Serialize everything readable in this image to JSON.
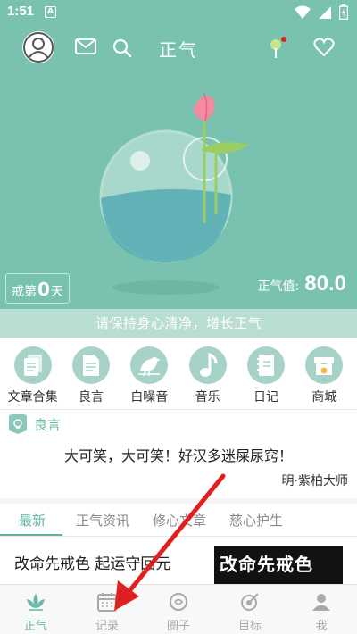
{
  "status_bar": {
    "time": "1:51",
    "badge": "A"
  },
  "topbar": {
    "title": "正气"
  },
  "hero": {
    "days_prefix": "戒第",
    "days_value": "0",
    "days_suffix": "天",
    "score_label": "正气值:",
    "score_value": "80.0",
    "slogan": "请保持身心清净，增长正气"
  },
  "quick_items": [
    {
      "label": "文章合集",
      "icon": "articles-icon"
    },
    {
      "label": "良言",
      "icon": "document-icon"
    },
    {
      "label": "白噪音",
      "icon": "bird-icon"
    },
    {
      "label": "音乐",
      "icon": "music-note-icon"
    },
    {
      "label": "日记",
      "icon": "diary-icon"
    },
    {
      "label": "商城",
      "icon": "shop-icon"
    }
  ],
  "quote": {
    "header": "良言",
    "text": "大可笑，大可笑！好汉多迷屎尿窍！",
    "author": "明·紫柏大师"
  },
  "tabs": [
    "最新",
    "正气资讯",
    "修心文章",
    "慈心护生"
  ],
  "article": {
    "title": "改命先戒色 起运守回元",
    "thumb_text": "改命先戒色"
  },
  "bottom_nav": [
    {
      "label": "正气",
      "icon": "lotus-icon",
      "active": true
    },
    {
      "label": "记录",
      "icon": "calendar-icon",
      "active": false
    },
    {
      "label": "圈子",
      "icon": "circle-icon",
      "active": false
    },
    {
      "label": "目标",
      "icon": "target-icon",
      "active": false
    },
    {
      "label": "我",
      "icon": "person-icon",
      "active": false
    }
  ],
  "colors": {
    "accent": "#79c2b0",
    "active_text": "#5fb3a0",
    "annotation": "#e02020"
  }
}
